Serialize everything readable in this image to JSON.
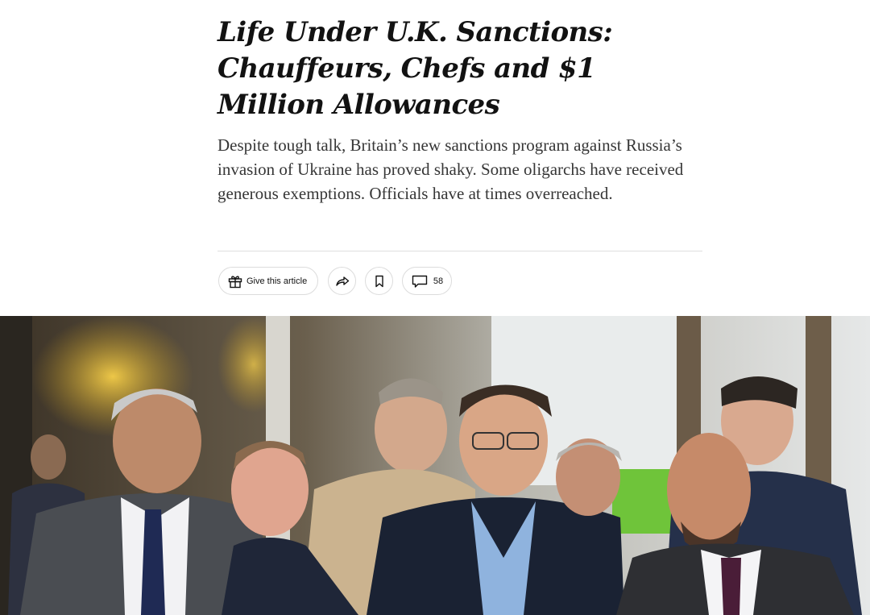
{
  "article": {
    "headline": "Life Under U.K. Sanctions: Chauffeurs, Chefs and $1 Million Allowances",
    "summary": "Despite tough talk, Britain’s new sanctions program against Russia’s invasion of Ukraine has proved shaky. Some oligarchs have received generous exemptions. Officials have at times overreached."
  },
  "share_tools": {
    "gift_label": "Give this article",
    "gift_icon": "gift-icon",
    "share_icon": "share-arrow-icon",
    "save_icon": "bookmark-icon",
    "comments_icon": "comment-bubble-icon",
    "comments_count": "58"
  },
  "colors": {
    "text": "#121212",
    "summary_text": "#363636",
    "divider": "#dfdfdf"
  }
}
